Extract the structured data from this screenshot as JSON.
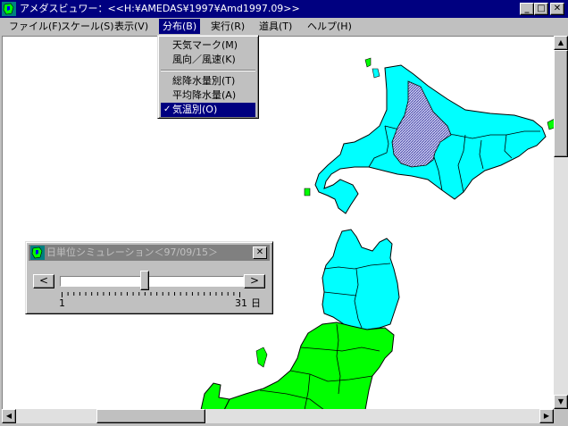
{
  "window": {
    "title": "アメダスビュワー：<<H:¥AMEDAS¥1997¥Amd1997.09>>",
    "controls": {
      "minimize": "_",
      "maximize": "□",
      "close": "✕"
    }
  },
  "menubar": {
    "items": [
      {
        "label": "ファイル(F)"
      },
      {
        "label": "スケール(S)"
      },
      {
        "label": "表示(V)"
      },
      {
        "label": "分布(B)"
      },
      {
        "label": "実行(R)"
      },
      {
        "label": "道具(T)"
      },
      {
        "label": "ヘルプ(H)"
      }
    ],
    "active_index": 3
  },
  "dropdown": {
    "items": [
      {
        "label": "天気マーク(M)",
        "checked": false,
        "selected": false
      },
      {
        "label": "風向／風速(K)",
        "checked": false,
        "selected": false
      },
      {
        "separator": true
      },
      {
        "label": "総降水量別(T)",
        "checked": false,
        "selected": false
      },
      {
        "label": "平均降水量(A)",
        "checked": false,
        "selected": false
      },
      {
        "label": "気温別(O)",
        "checked": true,
        "selected": true
      }
    ],
    "check_mark": "✓"
  },
  "simulation_dialog": {
    "title": "日単位シミュレーション＜97/09/15＞",
    "close": "✕",
    "prev_button": "<",
    "next_button": ">",
    "min_label": "1",
    "max_label": "31",
    "unit_label": "日",
    "current_day": 15,
    "min_day": 1,
    "max_day": 31
  },
  "scrollbars": {
    "up": "▲",
    "down": "▼",
    "left": "◀",
    "right": "▶"
  },
  "colors": {
    "titlebar": "#000080",
    "menu_highlight": "#000080",
    "cyan_region": "#00ffff",
    "green_region": "#00ff00",
    "hatched_region": "#9090d8",
    "window_face": "#c0c0c0"
  },
  "icons": {
    "app": "map-icon",
    "dialog": "map-icon"
  }
}
